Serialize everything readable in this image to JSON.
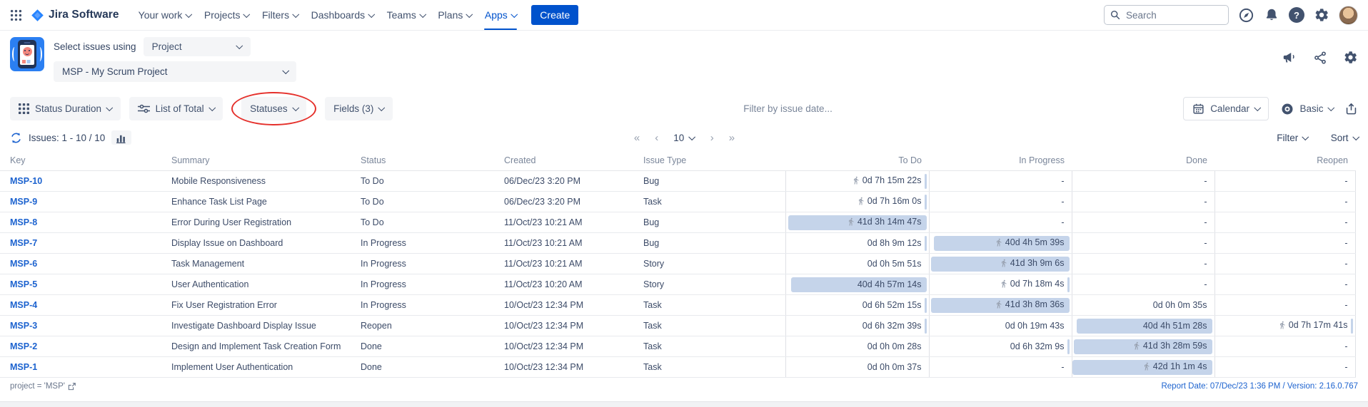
{
  "colors": {
    "accent_blue": "#0052CC",
    "nav_navy": "#42526E",
    "duration_bar_fill": "#c5d4ea",
    "annotation_red": "#E5302B",
    "link_blue": "#1d63cf"
  },
  "topnav": {
    "product_name": "Jira Software",
    "items": [
      "Your work",
      "Projects",
      "Filters",
      "Dashboards",
      "Teams",
      "Plans",
      "Apps"
    ],
    "active_item": "Apps",
    "create_label": "Create",
    "search_placeholder": "Search"
  },
  "app_header": {
    "select_issues_label": "Select issues using",
    "issue_source": "Project",
    "project_name": "MSP - My Scrum Project"
  },
  "toolbar": {
    "report_type": "Status Duration",
    "aggregation": "List of Total",
    "statuses_label": "Statuses",
    "fields_label": "Fields (3)",
    "date_filter_placeholder": "Filter by issue date...",
    "time_unit": "Calendar",
    "view_detail": "Basic"
  },
  "issues_bar": {
    "issues_count": "Issues: 1 - 10 / 10",
    "page_size": "10",
    "filter_label": "Filter",
    "sort_label": "Sort"
  },
  "icons": {
    "help_glyph": "?",
    "first_page": "«",
    "prev_page": "‹",
    "next_page": "›",
    "last_page": "»"
  },
  "table": {
    "columns": [
      "Key",
      "Summary",
      "Status",
      "Created",
      "Issue Type",
      "To Do",
      "In Progress",
      "Done",
      "Reopen"
    ],
    "rows": [
      {
        "key": "MSP-10",
        "summary": "Mobile Responsiveness",
        "status": "To Do",
        "created": "06/Dec/23 3:20 PM",
        "issue_type": "Bug",
        "durations": [
          {
            "text": "0d 7h 15m 22s",
            "running": true,
            "bar": 1.2
          },
          {
            "text": "-"
          },
          {
            "text": "-"
          },
          {
            "text": "-"
          }
        ]
      },
      {
        "key": "MSP-9",
        "summary": "Enhance Task List Page",
        "status": "To Do",
        "created": "06/Dec/23 3:20 PM",
        "issue_type": "Task",
        "durations": [
          {
            "text": "0d 7h 16m 0s",
            "running": true,
            "bar": 1.2
          },
          {
            "text": "-"
          },
          {
            "text": "-"
          },
          {
            "text": "-"
          }
        ]
      },
      {
        "key": "MSP-8",
        "summary": "Error During User Registration",
        "status": "To Do",
        "created": "11/Oct/23 10:21 AM",
        "issue_type": "Bug",
        "durations": [
          {
            "text": "41d 3h 14m 47s",
            "running": true,
            "bar": 97
          },
          {
            "text": "-"
          },
          {
            "text": "-"
          },
          {
            "text": "-"
          }
        ]
      },
      {
        "key": "MSP-7",
        "summary": "Display Issue on Dashboard",
        "status": "In Progress",
        "created": "11/Oct/23 10:21 AM",
        "issue_type": "Bug",
        "durations": [
          {
            "text": "0d 8h 9m 12s",
            "bar": 1.2
          },
          {
            "text": "40d 4h 5m 39s",
            "running": true,
            "bar": 95
          },
          {
            "text": "-"
          },
          {
            "text": "-"
          }
        ]
      },
      {
        "key": "MSP-6",
        "summary": "Task Management",
        "status": "In Progress",
        "created": "11/Oct/23 10:21 AM",
        "issue_type": "Story",
        "durations": [
          {
            "text": "0d 0h 5m 51s"
          },
          {
            "text": "41d 3h 9m 6s",
            "running": true,
            "bar": 97
          },
          {
            "text": "-"
          },
          {
            "text": "-"
          }
        ]
      },
      {
        "key": "MSP-5",
        "summary": "User Authentication",
        "status": "In Progress",
        "created": "11/Oct/23 10:20 AM",
        "issue_type": "Story",
        "durations": [
          {
            "text": "40d 4h 57m 14s",
            "bar": 95
          },
          {
            "text": "0d 7h 18m 4s",
            "running": true,
            "bar": 1.2
          },
          {
            "text": "-"
          },
          {
            "text": "-"
          }
        ]
      },
      {
        "key": "MSP-4",
        "summary": "Fix User Registration Error",
        "status": "In Progress",
        "created": "10/Oct/23 12:34 PM",
        "issue_type": "Task",
        "durations": [
          {
            "text": "0d 6h 52m 15s",
            "bar": 1.2
          },
          {
            "text": "41d 3h 8m 36s",
            "running": true,
            "bar": 97
          },
          {
            "text": "0d 0h 0m 35s"
          },
          {
            "text": "-"
          }
        ]
      },
      {
        "key": "MSP-3",
        "summary": "Investigate Dashboard Display Issue",
        "status": "Reopen",
        "created": "10/Oct/23 12:34 PM",
        "issue_type": "Task",
        "durations": [
          {
            "text": "0d 6h 32m 39s",
            "bar": 1.2
          },
          {
            "text": "0d 0h 19m 43s"
          },
          {
            "text": "40d 4h 51m 28s",
            "bar": 95
          },
          {
            "text": "0d 7h 17m 41s",
            "running": true,
            "bar": 1.2
          }
        ]
      },
      {
        "key": "MSP-2",
        "summary": "Design and Implement Task Creation Form",
        "status": "Done",
        "created": "10/Oct/23 12:34 PM",
        "issue_type": "Task",
        "durations": [
          {
            "text": "0d 0h 0m 28s"
          },
          {
            "text": "0d 6h 32m 9s",
            "bar": 1.2
          },
          {
            "text": "41d 3h 28m 59s",
            "running": true,
            "bar": 97
          },
          {
            "text": "-"
          }
        ]
      },
      {
        "key": "MSP-1",
        "summary": "Implement User Authentication",
        "status": "Done",
        "created": "10/Oct/23 12:34 PM",
        "issue_type": "Task",
        "durations": [
          {
            "text": "0d 0h 0m 37s"
          },
          {
            "text": "-"
          },
          {
            "text": "42d 1h 1m 4s",
            "running": true,
            "bar": 98
          },
          {
            "text": "-"
          }
        ]
      }
    ]
  },
  "footer": {
    "jql": "project = 'MSP'",
    "report_info": "Report Date: 07/Dec/23 1:36 PM / Version: 2.16.0.767"
  }
}
